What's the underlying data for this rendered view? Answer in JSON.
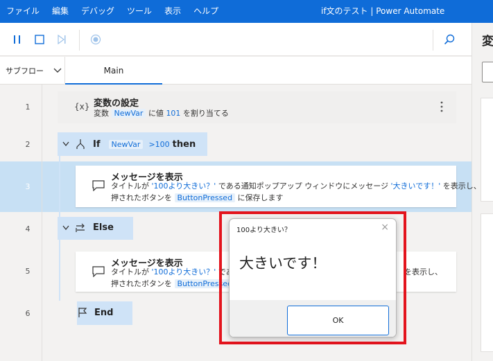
{
  "menu": [
    "ファイル",
    "編集",
    "デバッグ",
    "ツール",
    "表示",
    "ヘルプ"
  ],
  "window_title": "if文のテスト | Power Automate",
  "toolbar": {
    "pause_icon": "pause-icon",
    "stop_icon": "stop-icon",
    "step_icon": "next-step-icon",
    "record_icon": "record-icon",
    "search_icon": "search-icon"
  },
  "right_panel": {
    "title": "変"
  },
  "subflow": {
    "label": "サブフロー"
  },
  "tabs": {
    "main": "Main"
  },
  "lines": [
    "1",
    "2",
    "3",
    "4",
    "5",
    "6"
  ],
  "actions": {
    "set_var": {
      "icon": "{x}",
      "title": "変数の設定",
      "desc_prefix": "変数",
      "var_name": "NewVar",
      "desc_mid": "に値",
      "value": "101",
      "desc_suffix": "を割り当てる"
    },
    "if_block": {
      "label": "If",
      "var": "NewVar",
      "op": ">100",
      "then": "then"
    },
    "msg1": {
      "title": "メッセージを表示",
      "l1_prefix": "タイトルが",
      "l1_title": "'100より大きい？'",
      "l1_mid": "である通知ポップアップ ウィンドウにメッセージ",
      "l1_msg": "'大きいです！'",
      "l1_suffix": "を表示し、",
      "l2_prefix": "押されたボタンを",
      "l2_var": "ButtonPressed",
      "l2_suffix": "に保存します"
    },
    "else_block": {
      "label": "Else"
    },
    "msg2": {
      "title": "メッセージを表示",
      "l1_prefix": "タイトルが",
      "l1_title": "'100より大きい？'",
      "l1_mid": "である",
      "l1_suffix": "を表示し、",
      "l2_prefix": "押されたボタンを",
      "l2_var": "ButtonPressed2"
    },
    "end_block": {
      "label": "End"
    }
  },
  "dialog": {
    "title": "100より大きい？",
    "close": "×",
    "message": "大きいです！",
    "ok": "OK"
  },
  "colors": {
    "accent": "#0f6cd8",
    "highlight": "#c7e0f4",
    "block": "#cfe3f7",
    "redbox": "#e3141d"
  }
}
